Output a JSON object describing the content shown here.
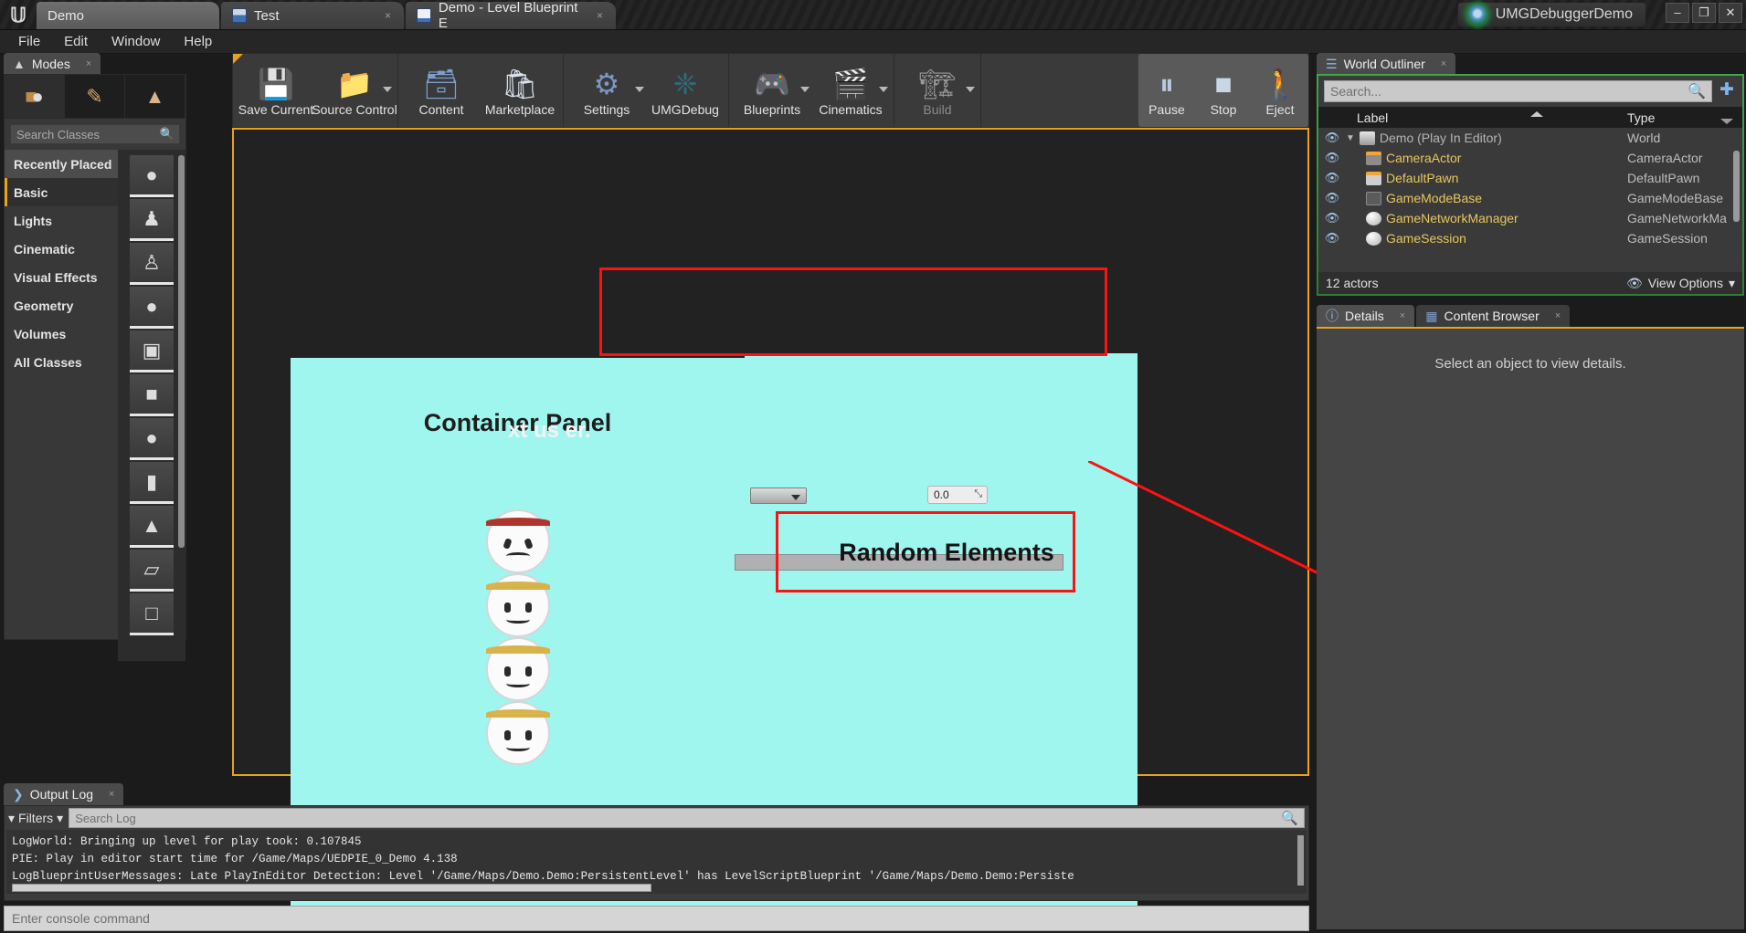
{
  "window": {
    "project_title": "UMGDebuggerDemo",
    "minimize": "–",
    "maximize": "❐",
    "close": "✕",
    "tabs": [
      {
        "label": "Demo",
        "icon": "unreal-logo-icon",
        "close": ""
      },
      {
        "label": "Test",
        "icon": "test-tab-icon",
        "close": "×"
      },
      {
        "label": "Demo - Level Blueprint E",
        "icon": "blueprint-icon",
        "close": "×"
      }
    ]
  },
  "menubar": {
    "items": [
      "File",
      "Edit",
      "Window",
      "Help"
    ]
  },
  "modes": {
    "tab_label": "Modes",
    "tab_close": "×",
    "mode_buttons": [
      {
        "name": "place-mode",
        "glyph": "⬛"
      },
      {
        "name": "paint-mode",
        "glyph": "✏"
      },
      {
        "name": "landscape-mode",
        "glyph": "⛰"
      }
    ],
    "search_placeholder": "Search Classes",
    "search_icon": "search-icon",
    "categories": [
      "Recently Placed",
      "Basic",
      "Lights",
      "Cinematic",
      "Visual Effects",
      "Geometry",
      "Volumes",
      "All Classes"
    ],
    "selected_category": "Basic",
    "assets": [
      {
        "name": "sphere-asset",
        "glyph": "●"
      },
      {
        "name": "player-start-asset",
        "glyph": "♟"
      },
      {
        "name": "pawn-asset",
        "glyph": "♙"
      },
      {
        "name": "point-light-asset",
        "glyph": "●"
      },
      {
        "name": "camera-asset",
        "glyph": "▣"
      },
      {
        "name": "cube-asset",
        "glyph": "■"
      },
      {
        "name": "sphere2-asset",
        "glyph": "●"
      },
      {
        "name": "cylinder-asset",
        "glyph": "▮"
      },
      {
        "name": "cone-asset",
        "glyph": "▲"
      },
      {
        "name": "plane-asset",
        "glyph": "▱"
      },
      {
        "name": "box-trigger-asset",
        "glyph": "□"
      }
    ]
  },
  "toolbar": {
    "groups": [
      {
        "buttons": [
          {
            "label": "Save Current",
            "icon": "save-icon",
            "glyph": "💾",
            "dropdown": false,
            "dim": false
          },
          {
            "label": "Source Control",
            "icon": "source-control-icon",
            "glyph": "📁",
            "dropdown": true,
            "dim": false
          }
        ]
      },
      {
        "buttons": [
          {
            "label": "Content",
            "icon": "content-browser-icon",
            "glyph": "🗂",
            "dropdown": false,
            "dim": false
          },
          {
            "label": "Marketplace",
            "icon": "marketplace-icon",
            "glyph": "🛍",
            "dropdown": false,
            "dim": false
          }
        ]
      },
      {
        "buttons": [
          {
            "label": "Settings",
            "icon": "settings-gear-icon",
            "glyph": "⚙",
            "dropdown": true,
            "dim": false
          },
          {
            "label": "UMGDebug",
            "icon": "umgdebug-icon",
            "glyph": "❈",
            "dropdown": false,
            "dim": false
          }
        ]
      },
      {
        "buttons": [
          {
            "label": "Blueprints",
            "icon": "blueprints-icon",
            "glyph": "🎮",
            "dropdown": true,
            "dim": false
          },
          {
            "label": "Cinematics",
            "icon": "cinematics-icon",
            "glyph": "🎬",
            "dropdown": true,
            "dim": false
          }
        ]
      },
      {
        "buttons": [
          {
            "label": "Build",
            "icon": "build-icon",
            "glyph": "🏗",
            "dropdown": true,
            "dim": true
          }
        ]
      }
    ],
    "play_controls": [
      {
        "label": "Pause",
        "icon": "pause-icon",
        "glyph": "⏸"
      },
      {
        "label": "Stop",
        "icon": "stop-icon",
        "glyph": "■"
      },
      {
        "label": "Eject",
        "icon": "eject-icon",
        "glyph": "🚶"
      }
    ]
  },
  "viewport": {
    "container_panel_title": "Container Panel",
    "overlay_text": "xt us                                       er.",
    "combo_value": "",
    "spin_value": "0.0",
    "spin_arrows": "⤡",
    "random_label": "Random Elements",
    "highlight_color": "#ff1111",
    "panel_color": "#9ff6ef",
    "faces": [
      {
        "name": "angry-face",
        "band": "#b0342e",
        "mouth": "frown"
      },
      {
        "name": "smile-face-1",
        "band": "#d8b24a",
        "mouth": "smile"
      },
      {
        "name": "smile-face-2",
        "band": "#d8b24a",
        "mouth": "smile"
      },
      {
        "name": "smile-face-3",
        "band": "#d8b24a",
        "mouth": "smile"
      }
    ]
  },
  "outliner": {
    "tab_label": "World Outliner",
    "tab_close": "×",
    "tab_icon": "outliner-list-icon",
    "search_placeholder": "Search...",
    "search_icon": "search-icon",
    "add_icon": "add-folder-icon",
    "columns": {
      "label": "Label",
      "type": "Type"
    },
    "rows": [
      {
        "label": "Demo (Play In Editor)",
        "type": "World",
        "icon": "world-icon",
        "is_world": true
      },
      {
        "label": "CameraActor",
        "type": "CameraActor",
        "icon": "camera-actor-icon",
        "is_world": false
      },
      {
        "label": "DefaultPawn",
        "type": "DefaultPawn",
        "icon": "pawn-icon",
        "is_world": false
      },
      {
        "label": "GameModeBase",
        "type": "GameModeBase",
        "icon": "gamemode-icon",
        "is_world": false
      },
      {
        "label": "GameNetworkManager",
        "type": "GameNetworkMa",
        "icon": "actor-icon",
        "is_world": false
      },
      {
        "label": "GameSession",
        "type": "GameSession",
        "icon": "actor-icon",
        "is_world": false
      }
    ],
    "actor_count": "12 actors",
    "view_options": "View Options",
    "view_options_icon": "eye-icon",
    "view_options_caret": "▾"
  },
  "details": {
    "tabs": [
      {
        "label": "Details",
        "icon": "details-info-icon",
        "close": "×",
        "active": true
      },
      {
        "label": "Content Browser",
        "icon": "content-browser-icon",
        "close": "×",
        "active": false
      }
    ],
    "empty_message": "Select an object to view details."
  },
  "output_log": {
    "tab_label": "Output Log",
    "tab_close": "×",
    "tab_icon": "console-icon",
    "filters_label": "Filters",
    "filters_icon": "filter-icon",
    "filters_caret": "▾",
    "search_placeholder": "Search Log",
    "search_icon": "search-icon",
    "lines": [
      "LogWorld: Bringing up level for play took: 0.107845",
      "PIE: Play in editor start time for /Game/Maps/UEDPIE_0_Demo 4.138",
      "LogBlueprintUserMessages: Late PlayInEditor Detection: Level '/Game/Maps/Demo.Demo:PersistentLevel' has LevelScriptBlueprint '/Game/Maps/Demo.Demo:Persiste"
    ],
    "console_placeholder": "Enter console command"
  }
}
